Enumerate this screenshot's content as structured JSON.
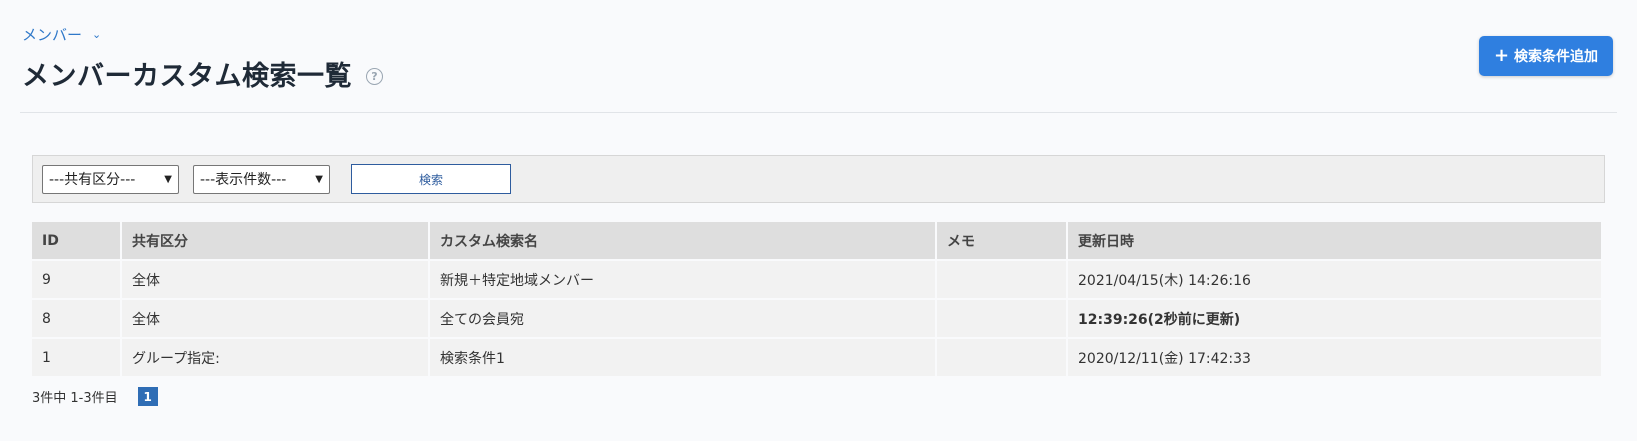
{
  "breadcrumb": {
    "label": "メンバー",
    "chevron": "chevron-down-icon"
  },
  "header": {
    "title": "メンバーカスタム検索一覧",
    "help_icon": "question-circle-icon",
    "help_glyph": "?"
  },
  "actions": {
    "add_label": "検索条件追加",
    "add_icon": "plus-icon",
    "add_glyph": "+"
  },
  "filters": {
    "share_select": "---共有区分---",
    "count_select": "---表示件数---",
    "search_label": "検索"
  },
  "table": {
    "headers": [
      "ID",
      "共有区分",
      "カスタム検索名",
      "メモ",
      "更新日時"
    ],
    "rows": [
      {
        "id": "9",
        "share": "全体",
        "name": "新規＋特定地域メンバー",
        "memo": "",
        "updated": "2021/04/15(木) 14:26:16"
      },
      {
        "id": "8",
        "share": "全体",
        "name": "全ての会員宛",
        "memo": "",
        "updated": "12:39:26(2秒前に更新)"
      },
      {
        "id": "1",
        "share": "グループ指定:",
        "name": "検索条件1",
        "memo": "",
        "updated": "2020/12/11(金) 17:42:33"
      }
    ]
  },
  "pager": {
    "summary": "3件中 1-3件目",
    "current_page": "1"
  },
  "colors": {
    "accent": "#2f7fe0",
    "link": "#2f78c9",
    "recent_update": "#5ba32b",
    "page_active": "#2f6db5"
  }
}
